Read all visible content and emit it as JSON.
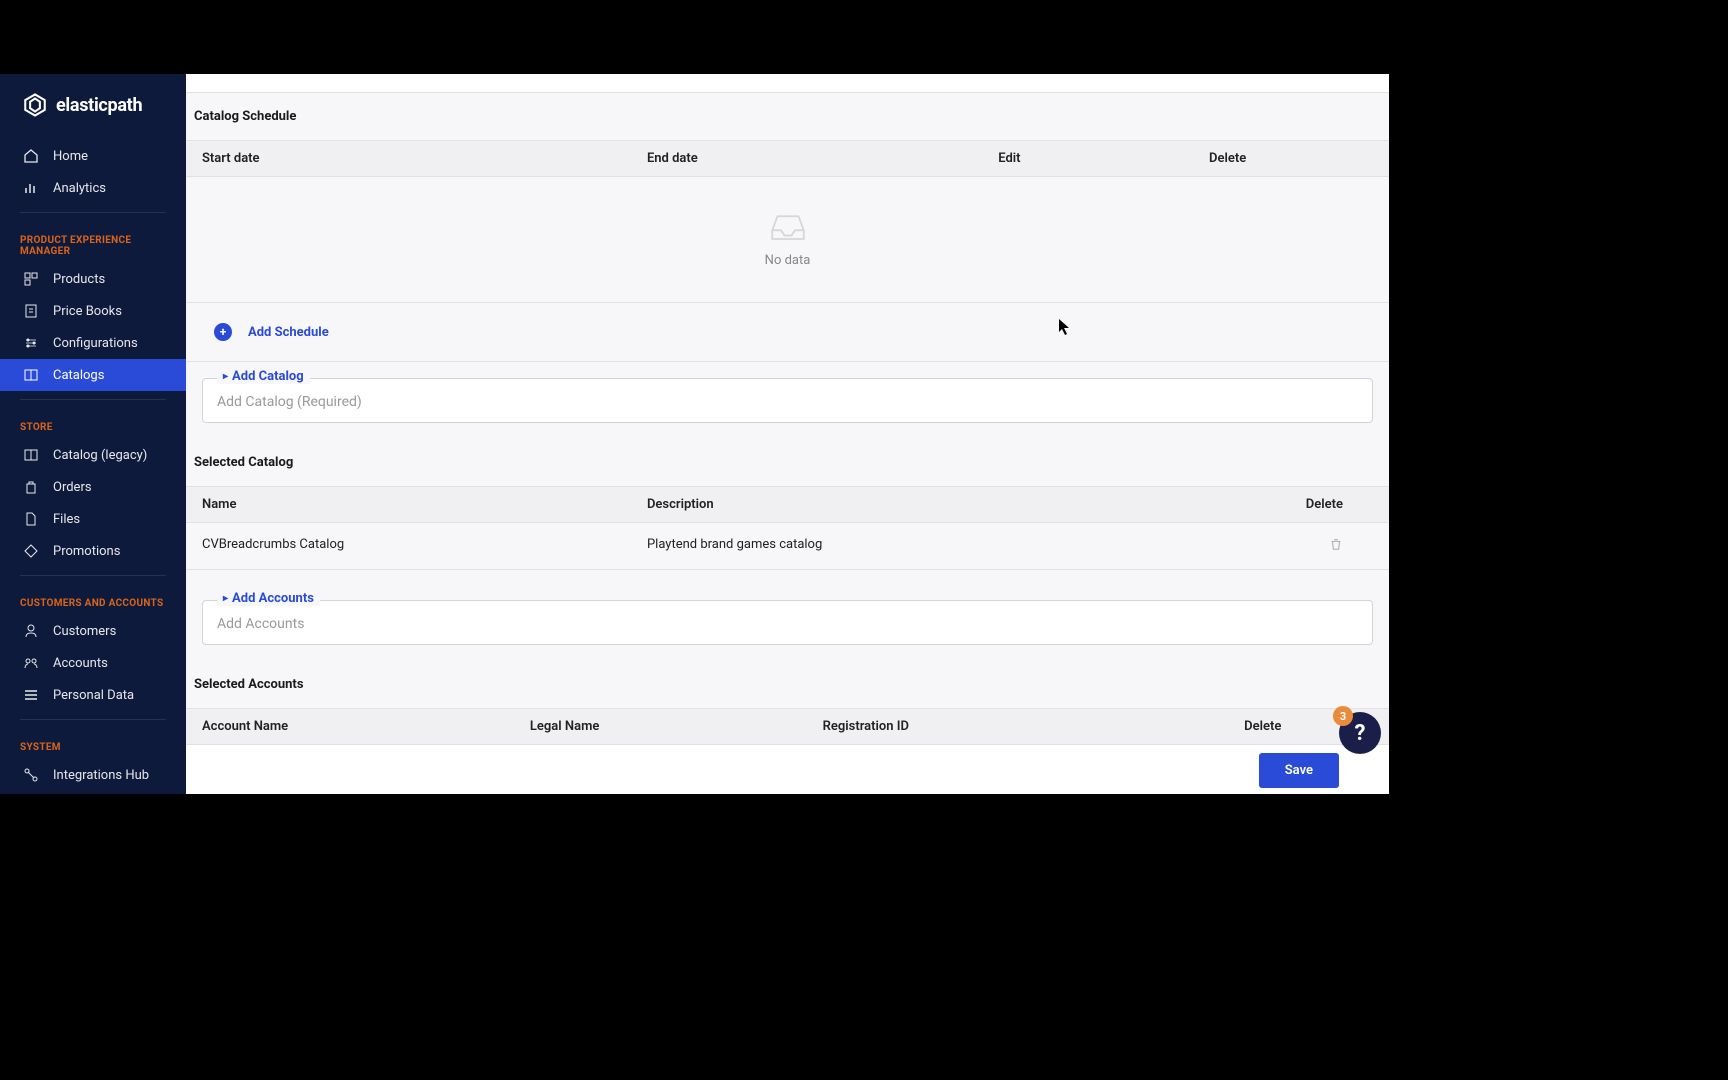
{
  "brand": "elasticpath",
  "sidebar": {
    "top": [
      {
        "label": "Home",
        "icon": "home-icon"
      },
      {
        "label": "Analytics",
        "icon": "analytics-icon"
      }
    ],
    "sections": [
      {
        "title": "PRODUCT EXPERIENCE MANAGER",
        "items": [
          {
            "label": "Products",
            "icon": "products-icon"
          },
          {
            "label": "Price Books",
            "icon": "pricebooks-icon"
          },
          {
            "label": "Configurations",
            "icon": "configurations-icon"
          },
          {
            "label": "Catalogs",
            "icon": "catalogs-icon",
            "active": true
          }
        ]
      },
      {
        "title": "STORE",
        "items": [
          {
            "label": "Catalog (legacy)",
            "icon": "catalog-legacy-icon"
          },
          {
            "label": "Orders",
            "icon": "orders-icon"
          },
          {
            "label": "Files",
            "icon": "files-icon"
          },
          {
            "label": "Promotions",
            "icon": "promotions-icon"
          }
        ]
      },
      {
        "title": "CUSTOMERS AND ACCOUNTS",
        "items": [
          {
            "label": "Customers",
            "icon": "customers-icon"
          },
          {
            "label": "Accounts",
            "icon": "accounts-icon"
          },
          {
            "label": "Personal Data",
            "icon": "personal-data-icon"
          }
        ]
      },
      {
        "title": "SYSTEM",
        "items": [
          {
            "label": "Integrations Hub",
            "icon": "integrations-icon"
          }
        ]
      }
    ]
  },
  "schedule": {
    "title": "Catalog Schedule",
    "cols": {
      "start": "Start date",
      "end": "End date",
      "edit": "Edit",
      "delete": "Delete"
    },
    "empty": "No data",
    "add": "Add Schedule"
  },
  "catalog": {
    "legend": "Add Catalog",
    "placeholder": "Add Catalog (Required)",
    "selected_title": "Selected Catalog",
    "cols": {
      "name": "Name",
      "desc": "Description",
      "delete": "Delete"
    },
    "rows": [
      {
        "name": "CVBreadcrumbs Catalog",
        "desc": "Playtend brand games catalog"
      }
    ]
  },
  "accounts": {
    "legend": "Add Accounts",
    "placeholder": "Add Accounts",
    "selected_title": "Selected Accounts",
    "cols": {
      "account": "Account Name",
      "legal": "Legal Name",
      "reg": "Registration ID",
      "delete": "Delete"
    }
  },
  "actions": {
    "save": "Save"
  },
  "help_badge": "3"
}
